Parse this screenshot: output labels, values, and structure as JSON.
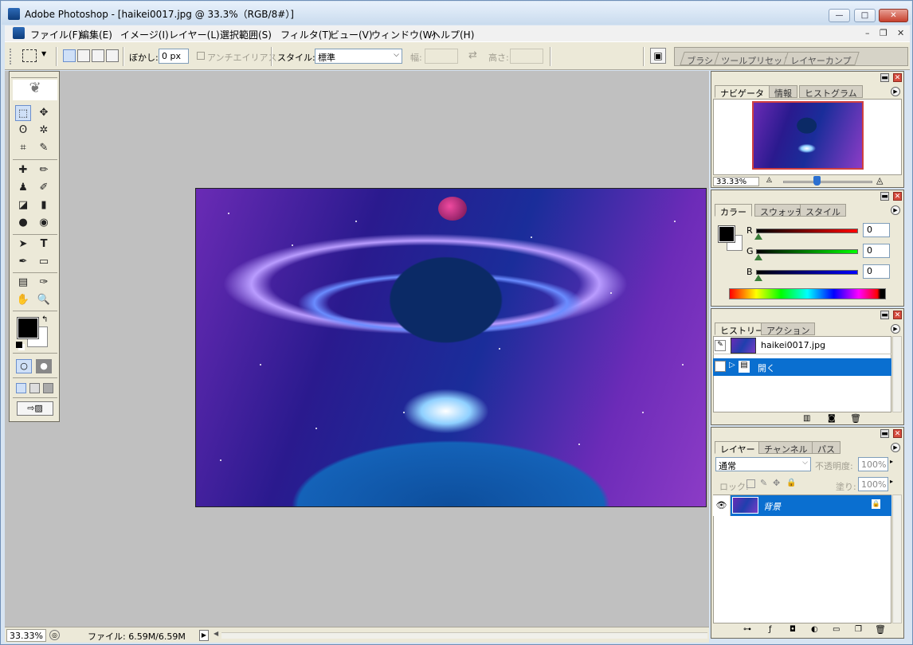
{
  "window": {
    "title": "Adobe Photoshop - [haikei0017.jpg @ 33.3%（RGB/8#）]",
    "controls": {
      "minimize": "—",
      "maximize": "□",
      "close": "✕"
    }
  },
  "menubar": {
    "items": [
      "ファイル(F)",
      "編集(E)",
      "イメージ(I)",
      "レイヤー(L)",
      "選択範囲(S)",
      "フィルタ(T)",
      "ビュー(V)",
      "ウィンドウ(W)",
      "ヘルプ(H)"
    ],
    "mdi": {
      "minimize": "–",
      "restore": "❐",
      "close": "✕"
    }
  },
  "options": {
    "feather_label": "ぼかし:",
    "feather_value": "0 px",
    "antialias_label": "アンチエイリアス",
    "style_label": "スタイル:",
    "style_value": "標準",
    "width_label": "幅:",
    "height_label": "高さ:",
    "swap": "⇄",
    "palette_tabs": [
      "ブラシ",
      "ツールプリセット",
      "レイヤーカンプ"
    ]
  },
  "toolbox": {
    "tools": [
      "⬚",
      "✥",
      "ʘ",
      "✲",
      "⌗",
      "✎",
      "✚",
      "✏",
      "♟",
      "✐",
      "◪",
      "▮",
      "●",
      "◉",
      "➤",
      "T",
      "✒",
      "▭",
      "▤",
      "✑",
      "✋",
      "🔍"
    ]
  },
  "navigator": {
    "tabs": [
      "ナビゲータ",
      "情報",
      "ヒストグラム"
    ],
    "zoom": "33.33%"
  },
  "color": {
    "tabs": [
      "カラー",
      "スウォッチ",
      "スタイル"
    ],
    "channels": [
      {
        "label": "R",
        "value": "0"
      },
      {
        "label": "G",
        "value": "0"
      },
      {
        "label": "B",
        "value": "0"
      }
    ]
  },
  "history": {
    "tabs": [
      "ヒストリー",
      "アクション"
    ],
    "snapshot": "haikei0017.jpg",
    "step": "開く"
  },
  "layers": {
    "tabs": [
      "レイヤー",
      "チャンネル",
      "パス"
    ],
    "blend_mode": "通常",
    "opacity_label": "不透明度:",
    "opacity_value": "100%",
    "lock_label": "ロック:",
    "fill_label": "塗り:",
    "fill_value": "100%",
    "layer_name": "背景"
  },
  "status": {
    "zoom": "33.33%",
    "file_info": "ファイル: 6.59M/6.59M"
  },
  "colors": {
    "selection": "#0a6fd0",
    "panel_bg": "#ece9d8",
    "canvas_bg": "#c0c0c0"
  }
}
